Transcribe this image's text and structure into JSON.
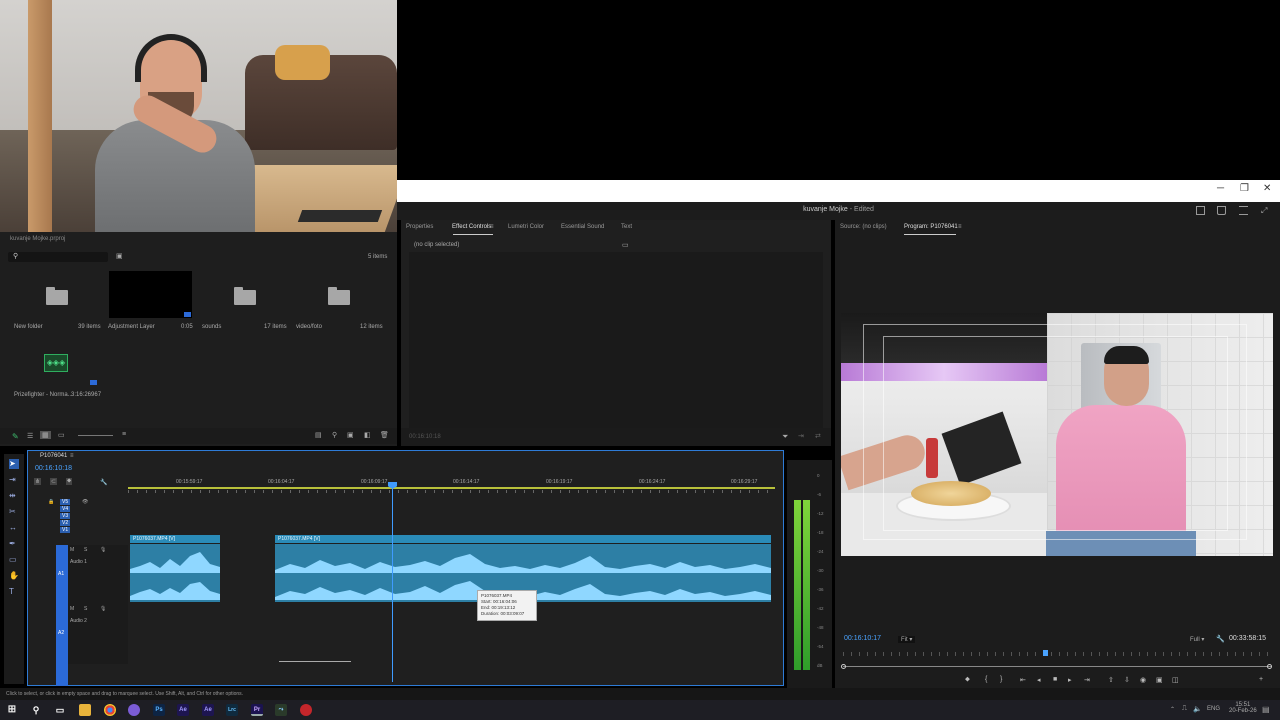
{
  "window": {
    "title": "kuvanje Mojke",
    "status": "- Edited",
    "min": "─",
    "max": "❐",
    "close": "✕"
  },
  "project": {
    "name": "kuvanje Mojke.prproj",
    "item_count": "5 items",
    "items": [
      {
        "label": "New folder",
        "meta": "39 items"
      },
      {
        "label": "Adjustment Layer",
        "meta": "0:05"
      },
      {
        "label": "sounds",
        "meta": "17 items"
      },
      {
        "label": "video/foto",
        "meta": "12 items"
      },
      {
        "label": "Prizefighter - Norma...",
        "meta": "3:16:26967"
      }
    ]
  },
  "effects": {
    "tabs": [
      "Properties",
      "Effect Controls",
      "Lumetri Color",
      "Essential Sound",
      "Text"
    ],
    "active_tab": "Effect Controls",
    "no_clip": "(no clip selected)",
    "timecode": "00:16:10:18"
  },
  "program": {
    "source_tab": "Source: (no clips)",
    "program_tab": "Program: P1076041",
    "current_time": "00:16:10:17",
    "fit": "Fit",
    "quality": "Full",
    "duration": "00:33:58:15"
  },
  "timeline": {
    "sequence": "P1076041",
    "timecode": "00:16:10:18",
    "ruler": [
      "00:15:59:17",
      "00:16:04:17",
      "00:16:09:17",
      "00:16:14:17",
      "00:16:19:17",
      "00:16:24:17",
      "00:16:29:17"
    ],
    "video_tracks": [
      "V5",
      "V4",
      "V3",
      "V2",
      "V1"
    ],
    "audio_tracks": [
      {
        "id": "A1",
        "name": "Audio 1"
      },
      {
        "id": "A2",
        "name": "Audio 2"
      }
    ],
    "clips": [
      {
        "label": "P1076037.MP4 [V]"
      },
      {
        "label": "P1076037.MP4 [V]"
      }
    ],
    "tooltip": {
      "name": "P1076037.MP4",
      "start": "Start: 00:16:04:06",
      "end": "End: 00:19:13:12",
      "duration": "Duration: 00:03:09:07"
    },
    "meter_scale": [
      "0",
      "-6",
      "-12",
      "-18",
      "-24",
      "-30",
      "-36",
      "-42",
      "-48",
      "-54",
      "dB"
    ]
  },
  "status_bar": "Click to select, or click in empty space and drag to marquee select. Use Shift, Alt, and Ctrl for other options.",
  "taskbar": {
    "apps": [
      "Ps",
      "Ae",
      "Ae",
      "Lrc",
      "Pr"
    ],
    "lang": "ENG",
    "time": "15:51",
    "date": "20-Feb-26"
  }
}
